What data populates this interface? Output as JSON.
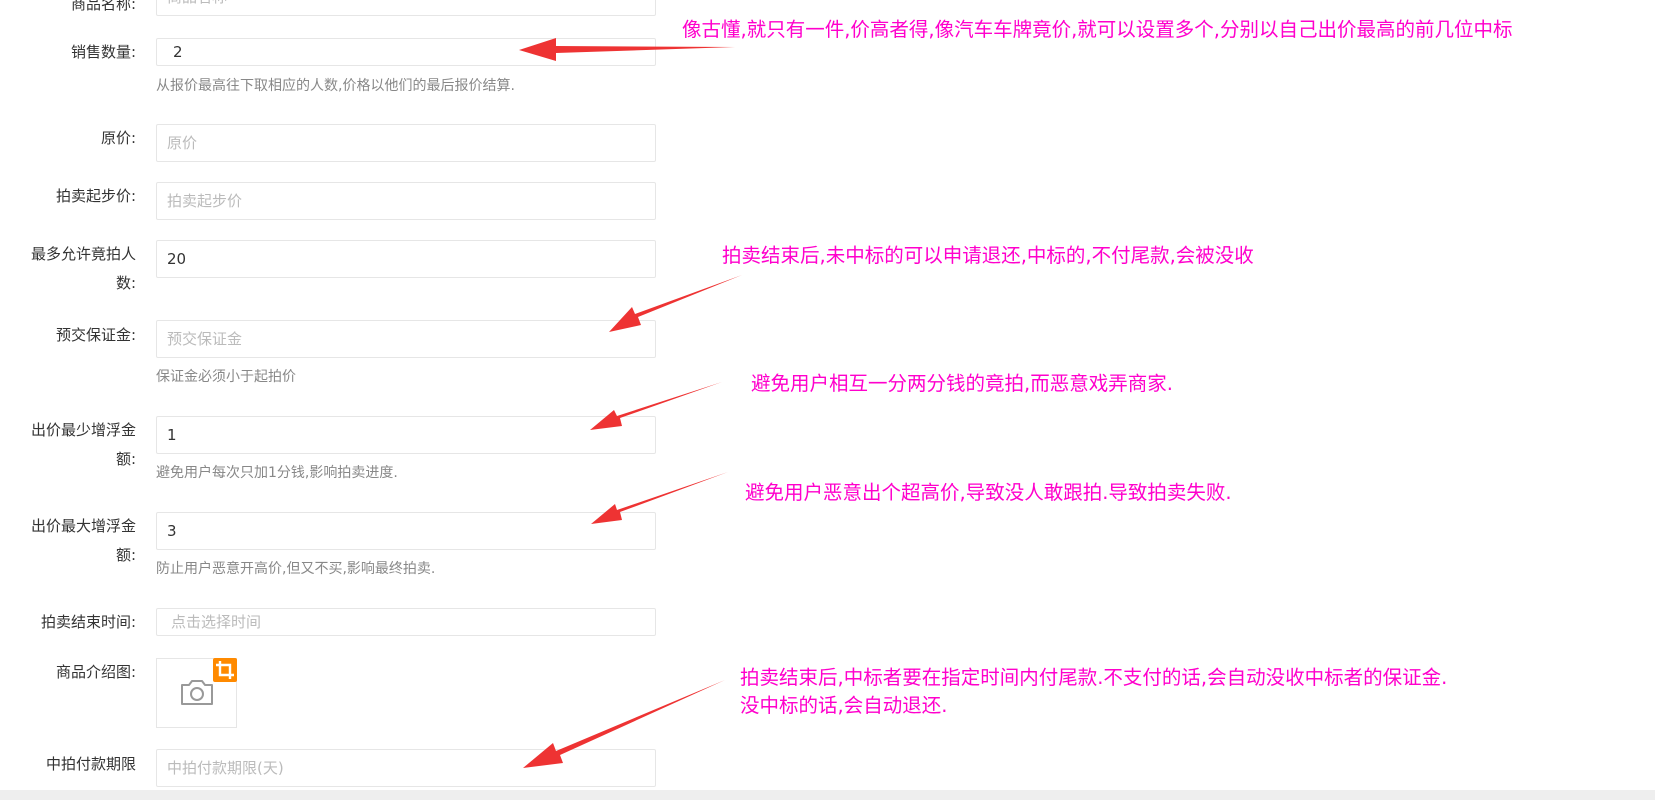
{
  "form": {
    "fields": [
      {
        "label": "商品名称:",
        "value": "",
        "placeholder": "商品名称"
      },
      {
        "label": "销售数量:",
        "value": "2",
        "placeholder": "",
        "help": "从报价最高往下取相应的人数,价格以他们的最后报价结算."
      },
      {
        "label": "原价:",
        "value": "",
        "placeholder": "原价"
      },
      {
        "label": "拍卖起步价:",
        "value": "",
        "placeholder": "拍卖起步价"
      },
      {
        "label_line1": "最多允许竟拍人",
        "label_line2": "数:",
        "value": "20",
        "placeholder": ""
      },
      {
        "label": "预交保证金:",
        "value": "",
        "placeholder": "预交保证金",
        "help": "保证金必须小于起拍价"
      },
      {
        "label_line1": "出价最少增浮金",
        "label_line2": "额:",
        "value": "1",
        "placeholder": "",
        "help": "避免用户每次只加1分钱,影响拍卖进度."
      },
      {
        "label_line1": "出价最大增浮金",
        "label_line2": "额:",
        "value": "3",
        "placeholder": "",
        "help": "防止用户恶意开高价,但又不买,影响最终拍卖."
      },
      {
        "label": "拍卖结束时间:",
        "value": "",
        "placeholder": "点击选择时间"
      },
      {
        "label": "商品介绍图:",
        "upload_icon": "camera-icon",
        "badge_icon": "crop-icon"
      },
      {
        "label": "中拍付款期限",
        "value": "",
        "placeholder": "中拍付款期限(天)"
      }
    ]
  },
  "annotations": [
    {
      "text": "像古懂,就只有一件,价高者得,像汽车车牌竟价,就可以设置多个,分别以自己出价最高的前几位中标"
    },
    {
      "text": "拍卖结束后,未中标的可以申请退还,中标的,不付尾款,会被没收"
    },
    {
      "text": "避免用户相互一分两分钱的竟拍,而恶意戏弄商家."
    },
    {
      "text": "避免用户恶意出个超高价,导致没人敢跟拍.导致拍卖失败."
    },
    {
      "line1": "拍卖结束后,中标者要在指定时间内付尾款.不支付的话,会自动没收中标者的保证金.",
      "line2": "没中标的话,会自动退还."
    }
  ],
  "colors": {
    "annotation": "#ff00cc",
    "arrow": "#ee3333",
    "badge": "#ff8a00",
    "input_border": "#e6e6e6",
    "placeholder": "#bbbbbb"
  }
}
